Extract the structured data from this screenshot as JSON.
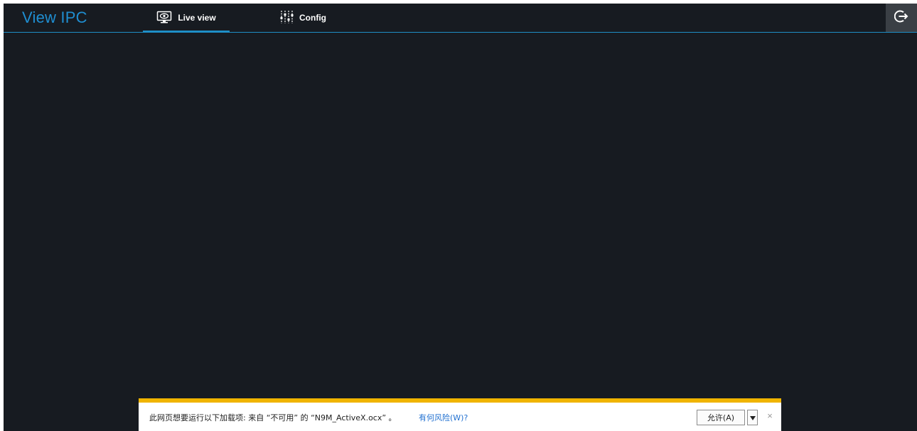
{
  "header": {
    "brand": "View IPC",
    "tabs": [
      {
        "label": "Live view",
        "icon": "monitor-eye-icon",
        "active": true
      },
      {
        "label": "Config",
        "icon": "sliders-icon",
        "active": false
      }
    ],
    "logout_icon": "logout-icon"
  },
  "notification_bar": {
    "message": "此网页想要运行以下加载项: 来自 “不可用” 的 “N9M_ActiveX.ocx” 。",
    "risk_link": "有何风险(W)?",
    "allow_button": "允许(A)",
    "close_symbol": "×",
    "accent_color": "#f0b400"
  },
  "colors": {
    "background": "#171b21",
    "accent": "#1e8fc7",
    "brand": "#1f8ed1"
  }
}
